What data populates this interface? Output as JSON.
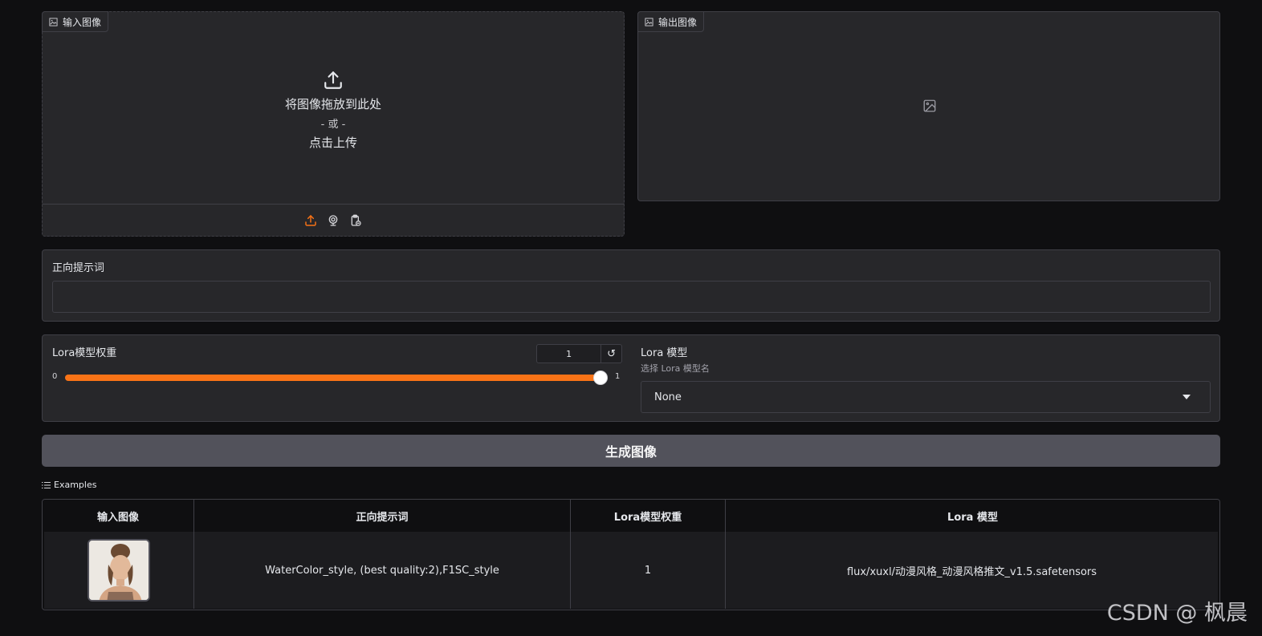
{
  "input_image": {
    "label": "输入图像",
    "drop_text": "将图像拖放到此处",
    "or_text": "- 或 -",
    "click_text": "点击上传"
  },
  "output_image": {
    "label": "输出图像"
  },
  "prompt": {
    "label": "正向提示词",
    "value": ""
  },
  "lora_weight": {
    "label": "Lora模型权重",
    "value": "1",
    "min": "0",
    "max": "1",
    "fill_fraction": 1.0
  },
  "lora_model": {
    "label": "Lora 模型",
    "info": "选择 Lora 模型名",
    "selected": "None"
  },
  "generate_button": "生成图像",
  "examples": {
    "title": "Examples",
    "headers": [
      "输入图像",
      "正向提示词",
      "Lora模型权重",
      "Lora 模型"
    ],
    "rows": [
      {
        "prompt": "WaterColor_style, (best quality:2),F1SC_style",
        "weight": "1",
        "model": "flux/xuxl/动漫风格_动漫风格推文_v1.5.safetensors"
      }
    ]
  },
  "watermark": "CSDN @ 枫晨",
  "colors": {
    "accent": "#f97316",
    "panel": "#27272a",
    "background": "#0f0f11",
    "button": "#52525b"
  }
}
